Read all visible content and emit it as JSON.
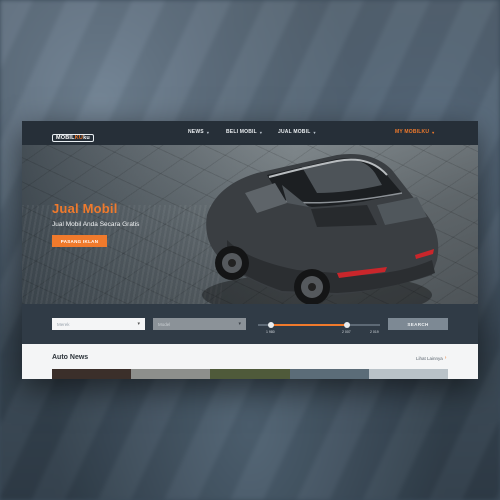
{
  "brand": {
    "logo_main": "MOBIL",
    "logo_accent": "KU",
    "logo_suffix": "ku",
    "tagline": "Indonesian Marketplace Since 1998"
  },
  "nav": {
    "items": [
      {
        "label": "NEWS",
        "has_caret": true
      },
      {
        "label": "BELI MOBIL",
        "has_caret": true
      },
      {
        "label": "JUAL MOBIL",
        "has_caret": true
      },
      {
        "label": "MY MOBILKU",
        "has_caret": true
      }
    ],
    "caret_glyph": "▾"
  },
  "hero": {
    "title": "Jual Mobil",
    "subtitle": "Jual Mobil Anda Secara Gratis",
    "cta_label": "PASANG IKLAN",
    "slides": 3,
    "active_slide": 3
  },
  "search": {
    "select1_placeholder": "Merek",
    "select2_placeholder": "Model",
    "range_min_label": "1 980",
    "range_selected_label": "2 007",
    "range_max_label": "2 019",
    "range_low_fraction": 0.09,
    "range_high_fraction": 0.72,
    "button_label": "SEARCH"
  },
  "news": {
    "title": "Auto News",
    "link_label": "Lihat Lainnya",
    "link_chevron": "›"
  },
  "colors": {
    "accent": "#f07a2c",
    "navbar": "#262f38",
    "search_bg": "#303b46"
  }
}
